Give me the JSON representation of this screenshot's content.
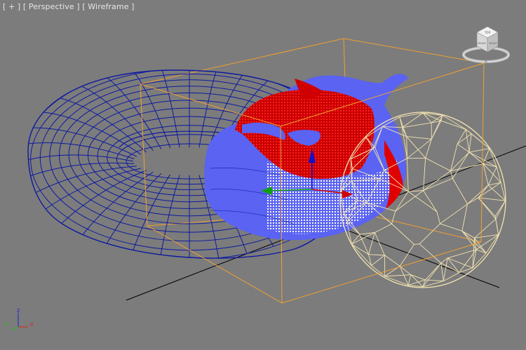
{
  "viewport": {
    "label_plus": "[ + ]",
    "label_view": "[ Perspective ]",
    "label_shading": "[ Wireframe ]"
  },
  "viewcube": {
    "face_top": "TOP",
    "face_front": "FRONT",
    "face_right": "RIGHT"
  },
  "axis_tripod": {
    "x": "x",
    "y": "y",
    "z": "z"
  },
  "colors": {
    "background": "#7c7c7c",
    "torus_wire": "#0d1aa0",
    "teapot_blue": "#5a63f2",
    "teapot_red": "#e00000",
    "sphere_wire": "#f3e3b0",
    "bbox_orange": "#f0a030"
  }
}
